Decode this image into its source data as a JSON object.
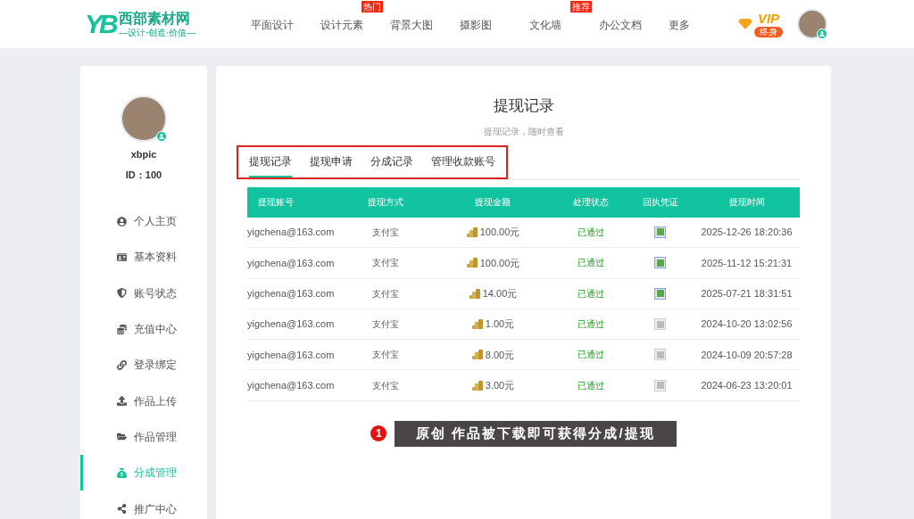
{
  "header": {
    "logo": {
      "mark": "YB",
      "name": "西部素材网",
      "slogan": "—设计·创造·价值—"
    },
    "nav": [
      {
        "label": "平面设计"
      },
      {
        "label": "设计元素",
        "badge": "热门"
      },
      {
        "label": "背景大图"
      },
      {
        "label": "摄影图"
      },
      {
        "label": "文化墙",
        "badge": "推荐"
      },
      {
        "label": "办公文档"
      },
      {
        "label": "更多"
      }
    ],
    "vip": {
      "label": "VIP",
      "tag": "终身"
    }
  },
  "sidebar": {
    "username": "xbpic",
    "id": "ID：100",
    "items": [
      {
        "label": "个人主页",
        "selected": false
      },
      {
        "label": "基本资料",
        "selected": false
      },
      {
        "label": "账号状态",
        "selected": false
      },
      {
        "label": "充值中心",
        "selected": false
      },
      {
        "label": "登录绑定",
        "selected": false
      },
      {
        "label": "作品上传",
        "selected": false
      },
      {
        "label": "作品管理",
        "selected": false
      },
      {
        "label": "分成管理",
        "selected": true
      },
      {
        "label": "推广中心",
        "selected": false
      }
    ]
  },
  "main": {
    "title": "提现记录",
    "subtitle": "提现记录，随时查看",
    "tabs": [
      {
        "label": "提现记录",
        "selected": true
      },
      {
        "label": "提现申请",
        "selected": false
      },
      {
        "label": "分成记录",
        "selected": false
      },
      {
        "label": "管理收款账号",
        "selected": false
      }
    ],
    "table": {
      "columns": [
        "提现账号",
        "提现方式",
        "提现金额",
        "处理状态",
        "回执凭证",
        "提现时间"
      ],
      "rows": [
        {
          "account": "yigchena@163.com",
          "method": "支付宝",
          "amount": "100.00元",
          "status": "已通过",
          "receipt": true,
          "time": "2025-12-26 18:20:36"
        },
        {
          "account": "yigchena@163.com",
          "method": "支付宝",
          "amount": "100.00元",
          "status": "已通过",
          "receipt": true,
          "time": "2025-11-12 15:21:31"
        },
        {
          "account": "yigchena@163.com",
          "method": "支付宝",
          "amount": "14.00元",
          "status": "已通过",
          "receipt": true,
          "time": "2025-07-21 18:31:51"
        },
        {
          "account": "yigchena@163.com",
          "method": "支付宝",
          "amount": "1.00元",
          "status": "已通过",
          "receipt": false,
          "time": "2024-10-20 13:02:56"
        },
        {
          "account": "yigchena@163.com",
          "method": "支付宝",
          "amount": "8.00元",
          "status": "已通过",
          "receipt": false,
          "time": "2024-10-09 20:57:28"
        },
        {
          "account": "yigchena@163.com",
          "method": "支付宝",
          "amount": "3.00元",
          "status": "已通过",
          "receipt": false,
          "time": "2024-06-23 13:20:01"
        }
      ]
    },
    "callout": {
      "number": "1",
      "text": "原创 作品被下载即可获得分成/提现"
    }
  }
}
